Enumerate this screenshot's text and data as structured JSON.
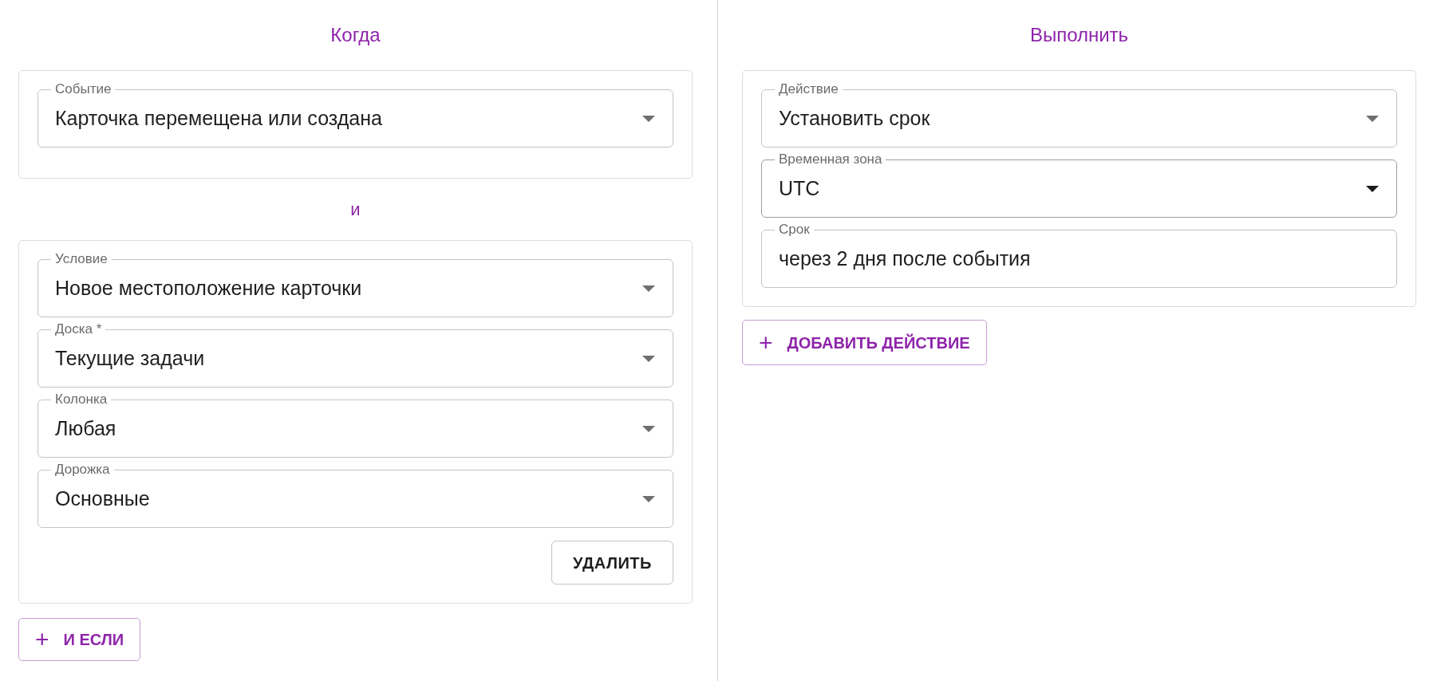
{
  "when": {
    "heading": "Когда",
    "event_card": {
      "fields": [
        {
          "kind": "select",
          "label": "Событие",
          "value": "Карточка перемещена или создана",
          "emphasized": false
        }
      ]
    },
    "joiner": "и",
    "condition_card": {
      "fields": [
        {
          "kind": "select",
          "label": "Условие",
          "value": "Новое местоположение карточки",
          "emphasized": false
        },
        {
          "kind": "select",
          "label": "Доска *",
          "value": "Текущие задачи",
          "emphasized": false
        },
        {
          "kind": "select",
          "label": "Колонка",
          "value": "Любая",
          "emphasized": false
        },
        {
          "kind": "select",
          "label": "Дорожка",
          "value": "Основные",
          "emphasized": false
        }
      ],
      "delete_button": "УДАЛИТЬ"
    },
    "add_button": {
      "icon": "+",
      "label": "И ЕСЛИ"
    }
  },
  "do": {
    "heading": "Выполнить",
    "action_card": {
      "fields": [
        {
          "kind": "select",
          "label": "Действие",
          "value": "Установить срок",
          "emphasized": false
        },
        {
          "kind": "select",
          "label": "Временная зона",
          "value": "UTC",
          "emphasized": true
        },
        {
          "kind": "text",
          "label": "Срок",
          "value": "через 2 дня после события",
          "emphasized": false
        }
      ]
    },
    "add_button": {
      "icon": "+",
      "label": "ДОБАВИТЬ ДЕЙСТВИЕ"
    }
  }
}
